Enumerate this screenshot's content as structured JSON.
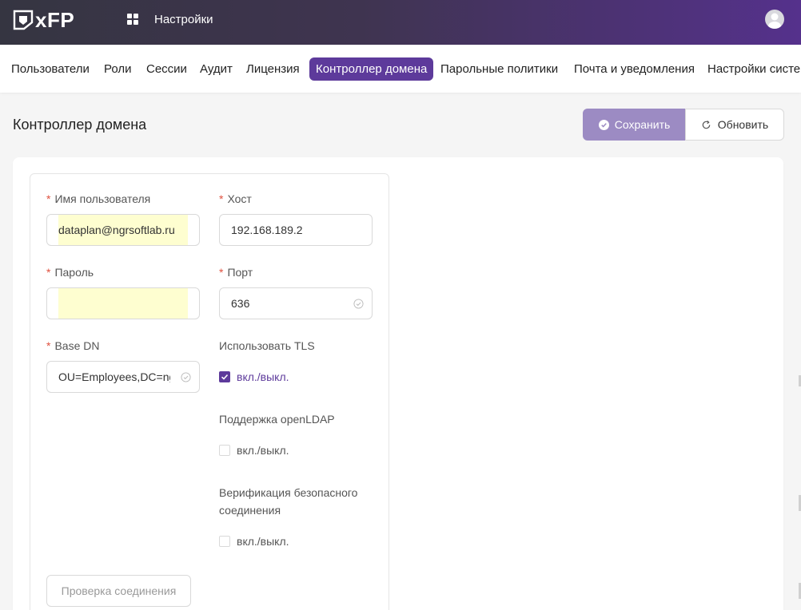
{
  "header": {
    "logo_text": "xFP",
    "title": "Настройки"
  },
  "tabs": [
    {
      "label": "Пользователи",
      "active": false
    },
    {
      "label": "Роли",
      "active": false
    },
    {
      "label": "Сессии",
      "active": false
    },
    {
      "label": "Аудит",
      "active": false
    },
    {
      "label": "Лицензия",
      "active": false
    },
    {
      "label": "Контроллер домена",
      "active": true
    },
    {
      "label": "Парольные политики",
      "active": false
    },
    {
      "label": "Почта и уведомления",
      "active": false
    },
    {
      "label": "Настройки систе",
      "active": false
    }
  ],
  "page": {
    "title": "Контроллер домена",
    "save_label": "Сохранить",
    "refresh_label": "Обновить"
  },
  "form": {
    "username": {
      "label": "Имя пользователя",
      "value": "dataplan@ngrsoftlab.ru"
    },
    "password": {
      "label": "Пароль",
      "value": ""
    },
    "base_dn": {
      "label": "Base DN",
      "value": "OU=Employees,DC=ngrsoftlab,DC=ru"
    },
    "host": {
      "label": "Хост",
      "value": "192.168.189.2"
    },
    "port": {
      "label": "Порт",
      "value": "636"
    },
    "tls": {
      "label": "Использовать TLS",
      "toggle": "вкл./выкл.",
      "checked": true
    },
    "openldap": {
      "label": "Поддержка openLDAP",
      "toggle": "вкл./выкл.",
      "checked": false
    },
    "verify": {
      "label_line1": "Верификация безопасного",
      "label_line2": "соединения",
      "toggle": "вкл./выкл.",
      "checked": false
    },
    "test_label": "Проверка соединения"
  },
  "colors": {
    "accent": "#5d3a9b",
    "save_button": "#9c8bc3",
    "required": "#e0513f",
    "autofill": "#fefed0"
  }
}
